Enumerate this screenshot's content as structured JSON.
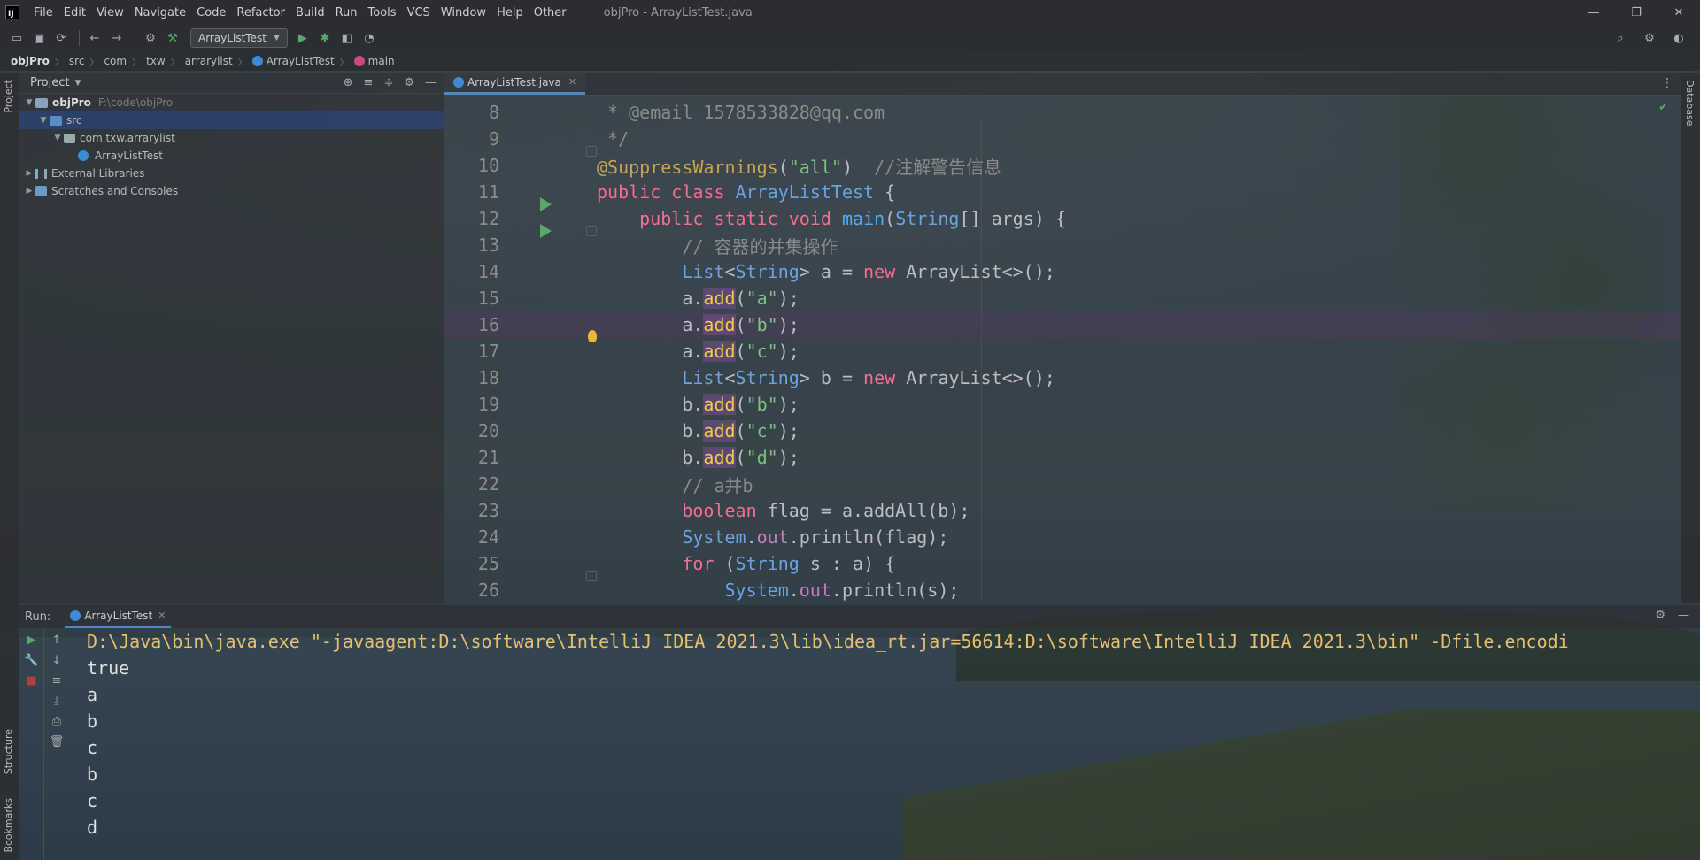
{
  "window": {
    "title": "objPro - ArrayListTest.java",
    "controls": [
      "—",
      "❐",
      "✕"
    ]
  },
  "menu": [
    "File",
    "Edit",
    "View",
    "Navigate",
    "Code",
    "Refactor",
    "Build",
    "Run",
    "Tools",
    "VCS",
    "Window",
    "Help",
    "Other"
  ],
  "app_logo": "IJ",
  "toolbar": {
    "run_config": "ArrayListTest",
    "icons": [
      "open-icon",
      "save-icon",
      "sync-icon",
      "back-icon",
      "forward-icon",
      "build-icon",
      "hammer-icon",
      "run-icon",
      "debug-icon",
      "coverage-icon",
      "profile-icon",
      "search-icon",
      "settings-icon"
    ]
  },
  "breadcrumb": [
    "objPro",
    "src",
    "com",
    "txw",
    "arrarylist",
    "ArrayListTest",
    "main"
  ],
  "project": {
    "header": "Project",
    "tree": [
      {
        "label": "objPro",
        "note": "F:\\code\\objPro",
        "level": 0,
        "type": "folder"
      },
      {
        "label": "src",
        "level": 1,
        "type": "folder-blue",
        "selected": true
      },
      {
        "label": "com.txw.arrarylist",
        "level": 2,
        "type": "package"
      },
      {
        "label": "ArrayListTest",
        "level": 3,
        "type": "class"
      },
      {
        "label": "External Libraries",
        "level": 0,
        "type": "lib"
      },
      {
        "label": "Scratches and Consoles",
        "level": 0,
        "type": "scratch"
      }
    ]
  },
  "left_tabs": [
    "Project",
    "Structure",
    "Bookmarks"
  ],
  "right_tabs": [
    "Database"
  ],
  "editor": {
    "tab": "ArrayListTest.java",
    "current_line": 16,
    "lines": [
      {
        "n": "8",
        "text": " * @email 1578533828@qq.com"
      },
      {
        "n": "9",
        "text": " */"
      },
      {
        "n": "10",
        "text": "@SuppressWarnings(\"all\")  //注解警告信息"
      },
      {
        "n": "11",
        "text": "public class ArrayListTest {"
      },
      {
        "n": "12",
        "text": "    public static void main(String[] args) {"
      },
      {
        "n": "13",
        "text": "        // 容器的并集操作"
      },
      {
        "n": "14",
        "text": "        List<String> a = new ArrayList<>();"
      },
      {
        "n": "15",
        "text": "        a.add(\"a\");"
      },
      {
        "n": "16",
        "text": "        a.add(\"b\");"
      },
      {
        "n": "17",
        "text": "        a.add(\"c\");"
      },
      {
        "n": "18",
        "text": "        List<String> b = new ArrayList<>();"
      },
      {
        "n": "19",
        "text": "        b.add(\"b\");"
      },
      {
        "n": "20",
        "text": "        b.add(\"c\");"
      },
      {
        "n": "21",
        "text": "        b.add(\"d\");"
      },
      {
        "n": "22",
        "text": "        // a并b"
      },
      {
        "n": "23",
        "text": "        boolean flag = a.addAll(b);"
      },
      {
        "n": "24",
        "text": "        System.out.println(flag);"
      },
      {
        "n": "25",
        "text": "        for (String s : a) {"
      },
      {
        "n": "26",
        "text": "            System.out.println(s);"
      }
    ]
  },
  "run": {
    "label": "Run:",
    "tab": "ArrayListTest",
    "command": "D:\\Java\\bin\\java.exe \"-javaagent:D:\\software\\IntelliJ IDEA 2021.3\\lib\\idea_rt.jar=56614:D:\\software\\IntelliJ IDEA 2021.3\\bin\" -Dfile.encodi",
    "output": [
      "true",
      "a",
      "b",
      "c",
      "b",
      "c",
      "d"
    ]
  },
  "colors": {
    "keyword": "#cf8e6d",
    "string": "#7fc27f",
    "comment": "#8b8b8b",
    "class": "#6aa3e0",
    "annotation": "#c9a64e",
    "selection": "#2e436e",
    "console_cmd": "#e8bf6a"
  }
}
